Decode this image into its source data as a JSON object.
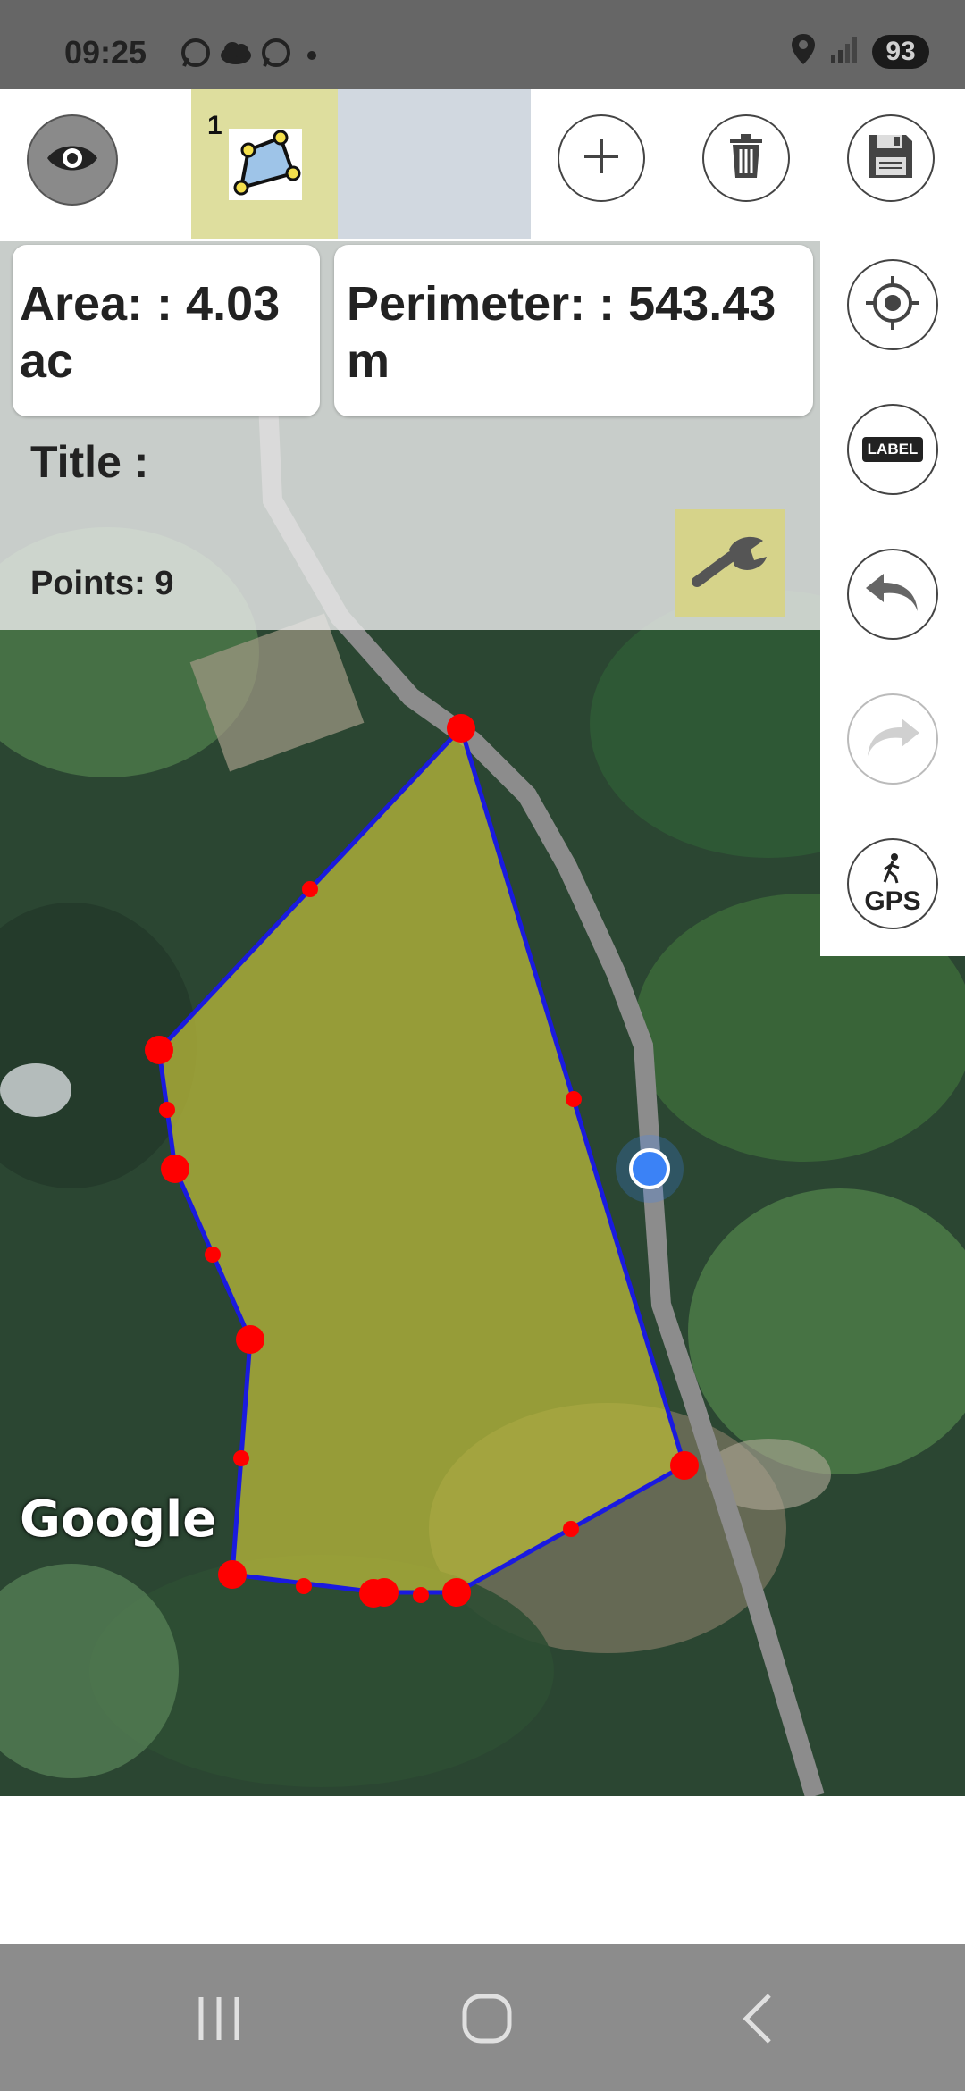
{
  "status_bar": {
    "time": "09:25",
    "battery": "93"
  },
  "toolbar": {
    "shape_tab_number": "1"
  },
  "info": {
    "area_label": "Area: : 4.03 ac",
    "perimeter_label": "Perimeter: : 543.43 m",
    "title_label": "Title :",
    "points_label": "Points: 9"
  },
  "right_rail": {
    "label_button_text": "LABEL",
    "gps_button_text": "GPS"
  },
  "map": {
    "attribution": "Google",
    "polygon_fill": "#b5b53a",
    "polygon_stroke": "#1a1adf",
    "vertex_color": "#ff0000",
    "location_dot_color": "#3b82f6"
  }
}
